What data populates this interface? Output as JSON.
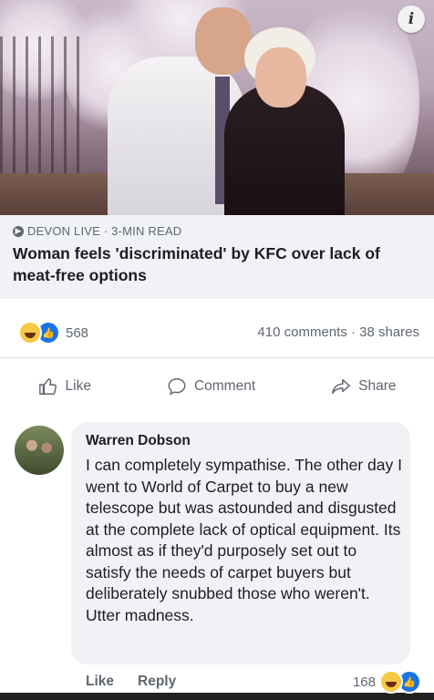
{
  "post": {
    "source": "DEVON LIVE · 3-MIN READ",
    "headline": "Woman feels 'discriminated' by KFC over lack of meat-free options",
    "info_icon": "info-icon"
  },
  "stats": {
    "reaction_count": "568",
    "comments_shares": "410 comments · 38 shares"
  },
  "actions": {
    "like": "Like",
    "comment": "Comment",
    "share": "Share"
  },
  "comment": {
    "author": "Warren Dobson",
    "text": "I can completely sympathise. The other day I went to World of Carpet to buy a new telescope but was astounded and disgusted at the complete lack of optical equipment. Its almost as if they'd purposely set out to satisfy the needs of carpet buyers but deliberately snubbed those who weren't. Utter madness.",
    "like_label": "Like",
    "reply_label": "Reply",
    "reaction_count": "168"
  },
  "colors": {
    "like_blue": "#1b74e4",
    "haha_yellow": "#f7c843",
    "muted_text": "#606770"
  }
}
